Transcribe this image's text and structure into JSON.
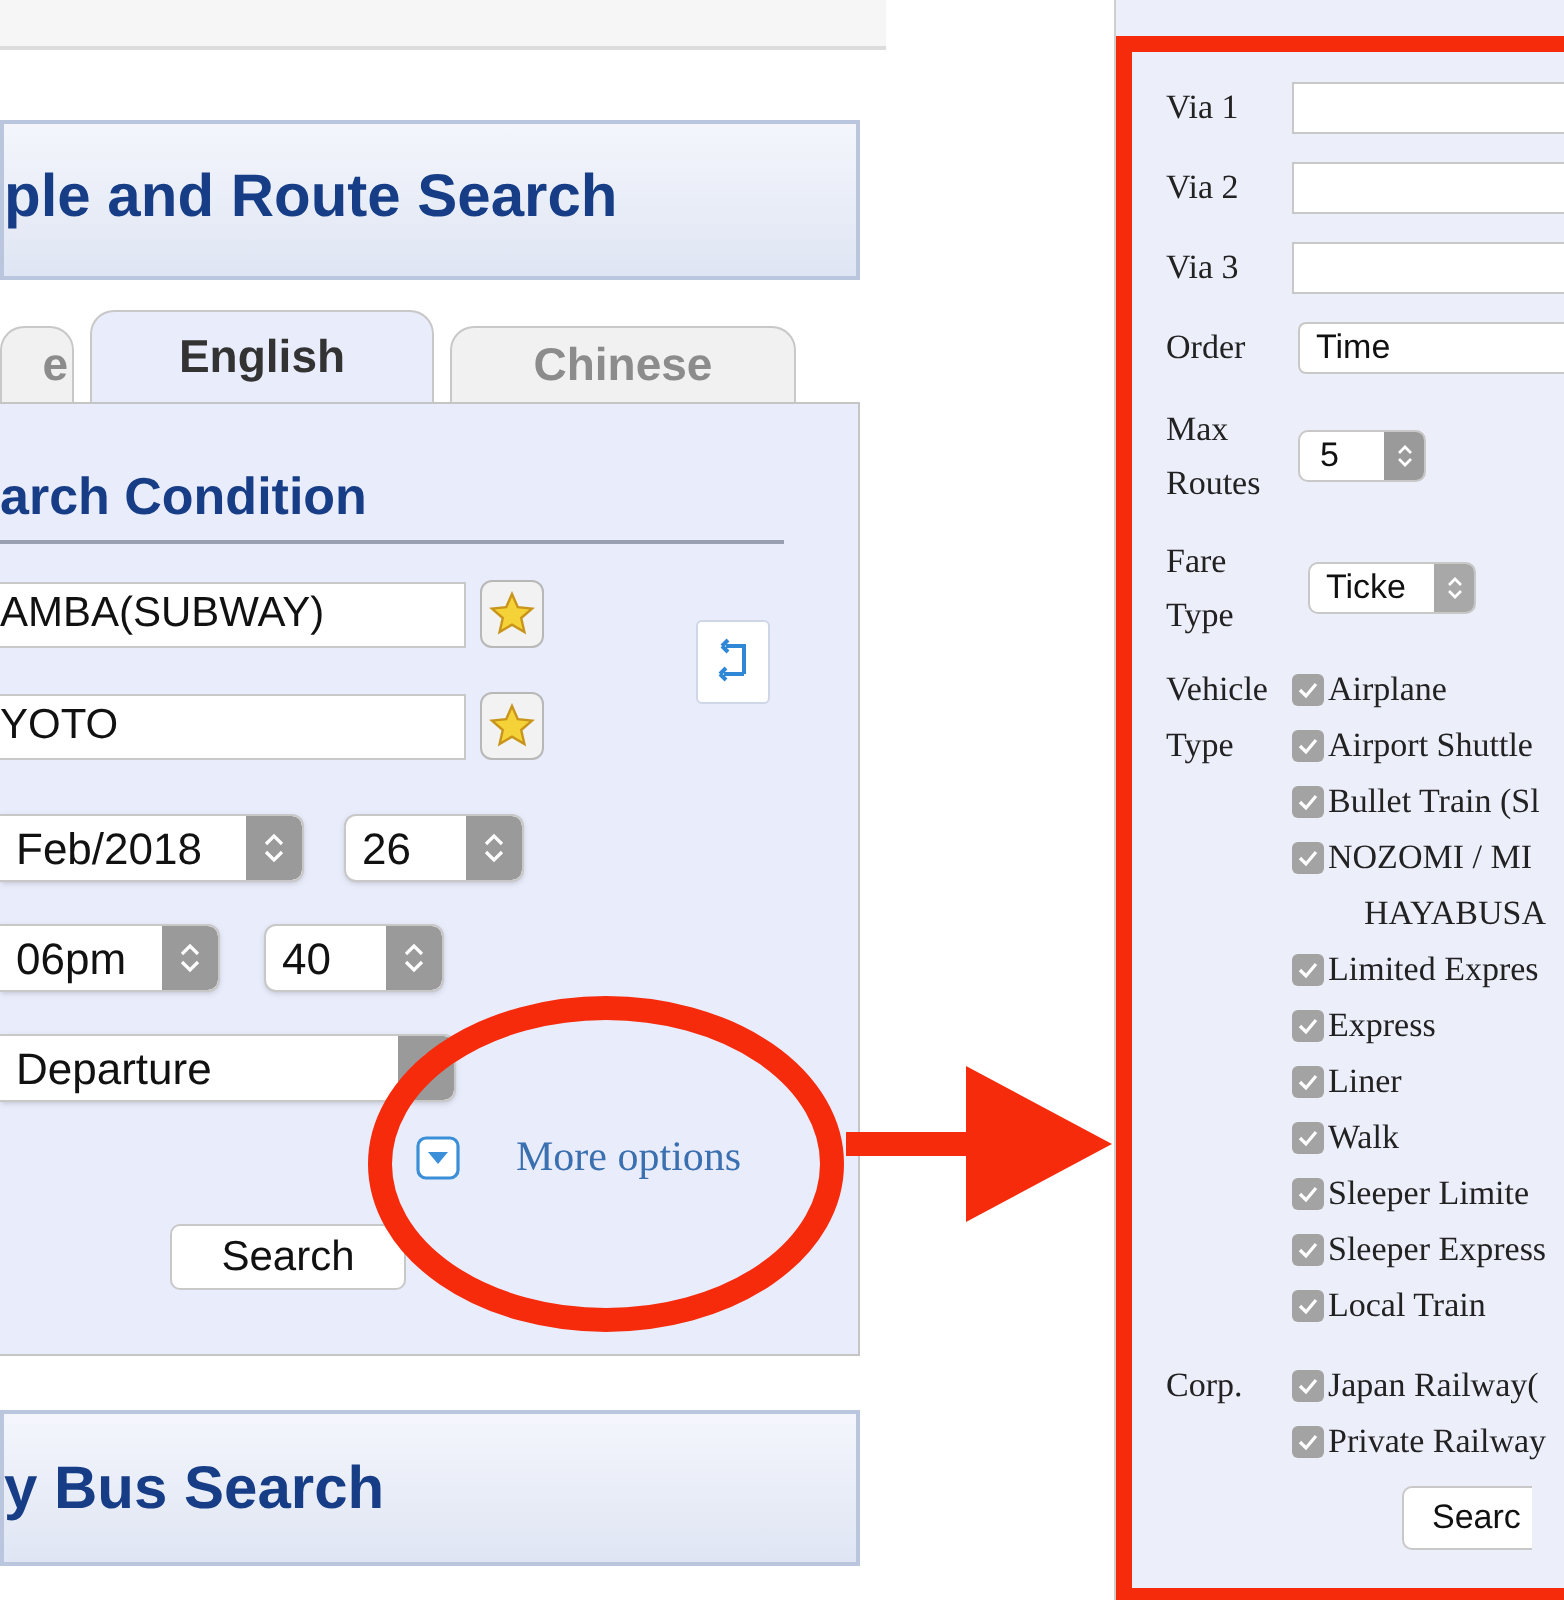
{
  "left": {
    "title": "ple and Route Search",
    "tabs": [
      {
        "label": "e",
        "selected": false
      },
      {
        "label": "English",
        "selected": true
      },
      {
        "label": "Chinese",
        "selected": false
      }
    ],
    "heading": "arch Condition",
    "from": "AMBA(SUBWAY)",
    "to": "YOTO",
    "month": "Feb/2018",
    "day": "26",
    "hour": "06pm",
    "minute": "40",
    "mode": "Departure",
    "more_options": "More options",
    "search": "Search",
    "bus_title": "y Bus Search"
  },
  "right": {
    "vias": [
      {
        "label": "Via 1"
      },
      {
        "label": "Via 2"
      },
      {
        "label": "Via 3"
      }
    ],
    "order": {
      "label": "Order",
      "value": "Time"
    },
    "max_routes": {
      "label": "Max Routes",
      "value": "5"
    },
    "fare_type": {
      "label": "Fare Type",
      "value": "Ticke"
    },
    "vehicle": {
      "label": "Vehicle Type",
      "items": [
        {
          "lines": [
            "Airplane"
          ],
          "checked": true
        },
        {
          "lines": [
            "Airport Shuttle"
          ],
          "checked": true
        },
        {
          "lines": [
            "Bullet Train (Sl"
          ],
          "checked": true
        },
        {
          "lines": [
            "NOZOMI / MI",
            "HAYABUSA"
          ],
          "checked": true
        },
        {
          "lines": [
            "Limited Expres"
          ],
          "checked": true
        },
        {
          "lines": [
            "Express"
          ],
          "checked": true
        },
        {
          "lines": [
            "Liner"
          ],
          "checked": true
        },
        {
          "lines": [
            "Walk"
          ],
          "checked": true
        },
        {
          "lines": [
            "Sleeper Limite"
          ],
          "checked": true
        },
        {
          "lines": [
            "Sleeper Express"
          ],
          "checked": true
        },
        {
          "lines": [
            "Local Train"
          ],
          "checked": true
        }
      ]
    },
    "corp": {
      "label": "Corp.",
      "items": [
        {
          "lines": [
            "Japan Railway("
          ],
          "checked": true
        },
        {
          "lines": [
            "Private Railway"
          ],
          "checked": true
        }
      ]
    },
    "search": "Searc"
  }
}
